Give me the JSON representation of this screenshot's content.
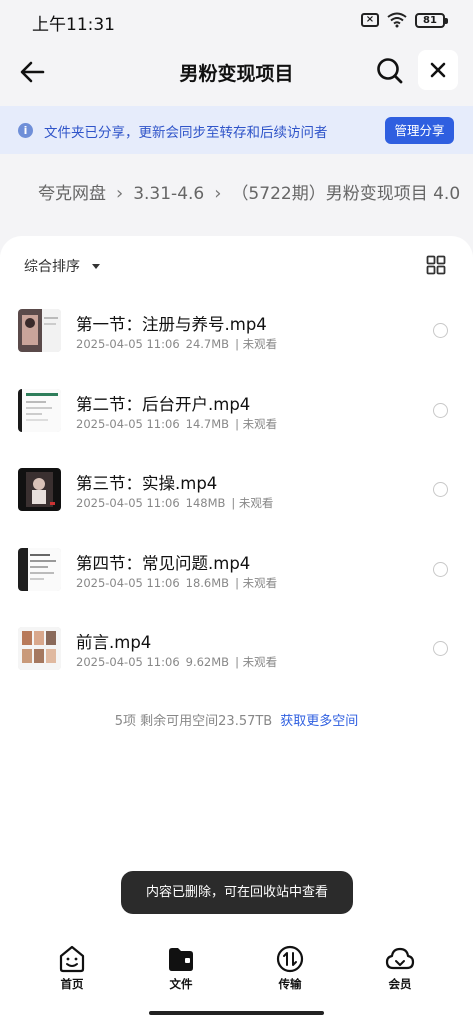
{
  "status_bar": {
    "time": "上午11:31",
    "battery": "81"
  },
  "header": {
    "title": "男粉变现项目"
  },
  "share_banner": {
    "text": "文件夹已分享，更新会同步至转存和后续访问者",
    "button": "管理分享"
  },
  "breadcrumb": [
    "夸克网盘",
    "3.31-4.6",
    "（5722期）男粉变现项目 4.0"
  ],
  "sort": {
    "label": "综合排序"
  },
  "files": [
    {
      "name": "第一节：注册与养号.mp4",
      "date": "2025-04-05 11:06",
      "size": "24.7MB",
      "status": "| 未观看"
    },
    {
      "name": "第二节：后台开户.mp4",
      "date": "2025-04-05 11:06",
      "size": "14.7MB",
      "status": "| 未观看"
    },
    {
      "name": "第三节：实操.mp4",
      "date": "2025-04-05 11:06",
      "size": "148MB",
      "status": "| 未观看"
    },
    {
      "name": "第四节：常见问题.mp4",
      "date": "2025-04-05 11:06",
      "size": "18.6MB",
      "status": "| 未观看"
    },
    {
      "name": "前言.mp4",
      "date": "2025-04-05 11:06",
      "size": "9.62MB",
      "status": "| 未观看"
    }
  ],
  "summary": {
    "text": "5项  剩余可用空间23.57TB",
    "link": "获取更多空间"
  },
  "toast": "内容已删除，可在回收站中查看",
  "nav": [
    {
      "label": "首页",
      "icon": "smile-face-icon"
    },
    {
      "label": "文件",
      "icon": "folder-icon"
    },
    {
      "label": "传输",
      "icon": "transfer-icon"
    },
    {
      "label": "会员",
      "icon": "cloud-icon"
    }
  ],
  "colors": {
    "accent": "#2f5fe0",
    "banner_bg": "#e6ecfb",
    "banner_text": "#2f54c9",
    "toast_bg": "#2b2b2b"
  }
}
